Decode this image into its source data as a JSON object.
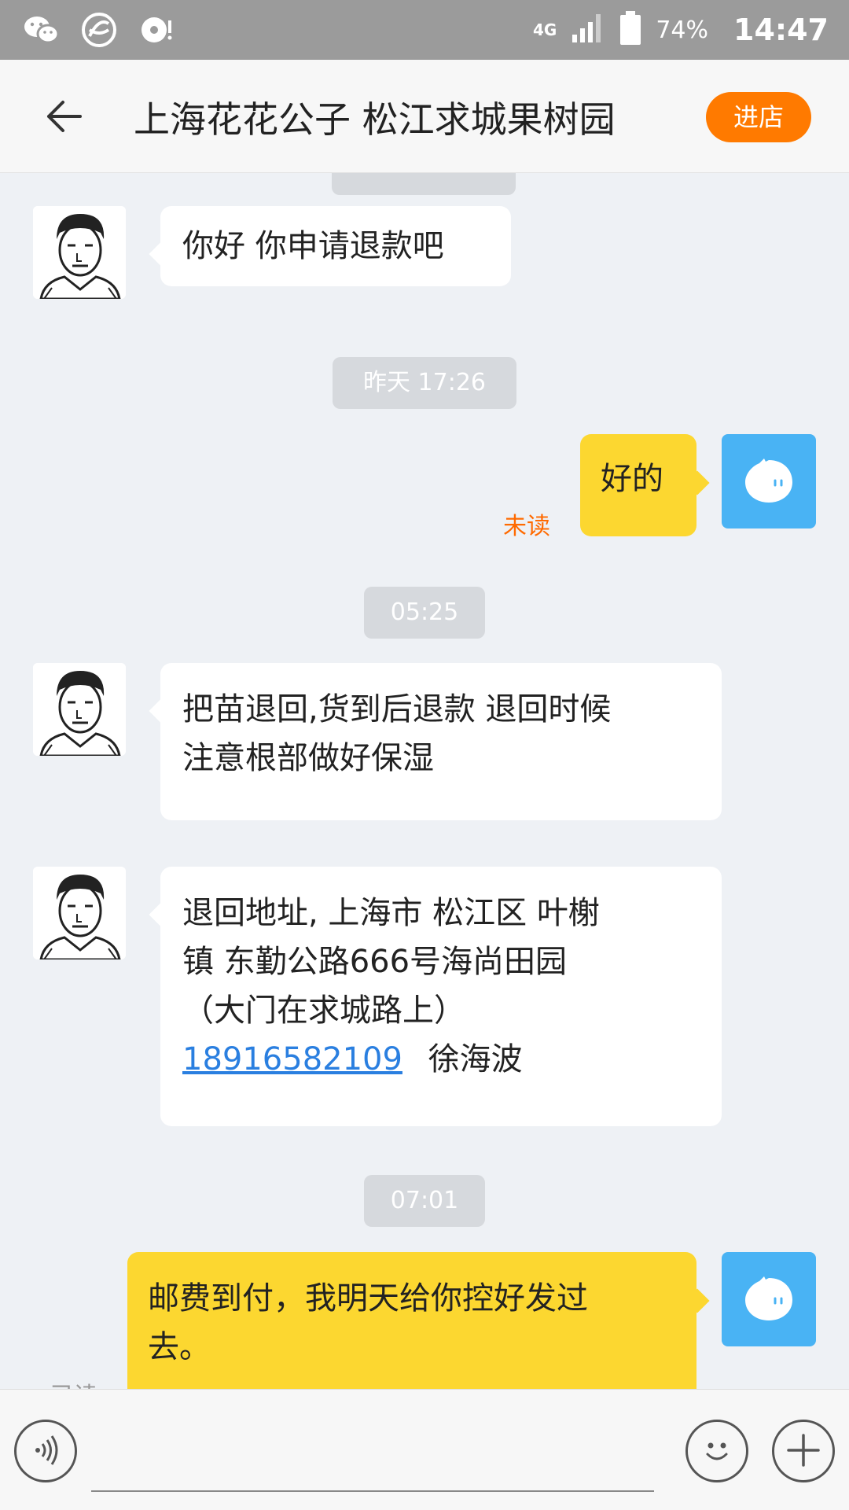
{
  "status_bar": {
    "network": "4G",
    "battery": "74%",
    "time": "14:47"
  },
  "header": {
    "title": "上海花花公子 松江求城果树园",
    "enter_shop": "进店"
  },
  "messages": [
    {
      "type": "in",
      "text": "你好 你申请退款吧"
    },
    {
      "type": "time",
      "text": "昨天 17:26"
    },
    {
      "type": "out",
      "text": "好的",
      "status": "未读"
    },
    {
      "type": "time",
      "text": "05:25"
    },
    {
      "type": "in",
      "lines": [
        "把苗退回,货到后退款  退回时候",
        "注意根部做好保湿"
      ]
    },
    {
      "type": "in",
      "lines": [
        "退回地址, 上海市 松江区 叶榭",
        "镇 东勤公路666号海尚田园",
        "（大门在求城路上）"
      ],
      "phone": "18916582109",
      "name": "徐海波"
    },
    {
      "type": "time",
      "text": "07:01"
    },
    {
      "type": "out",
      "lines": [
        "邮费到付，我明天给你控好发过",
        "去。"
      ],
      "status": "已读"
    }
  ],
  "input": {
    "voice_icon": "voice-icon",
    "emoji_icon": "emoji-icon",
    "plus_icon": "plus-icon"
  },
  "colors": {
    "accent": "#ff7a00",
    "bubble_out": "#fcd730",
    "avatar_blue": "#49b3f4",
    "link": "#2a7fe0"
  }
}
